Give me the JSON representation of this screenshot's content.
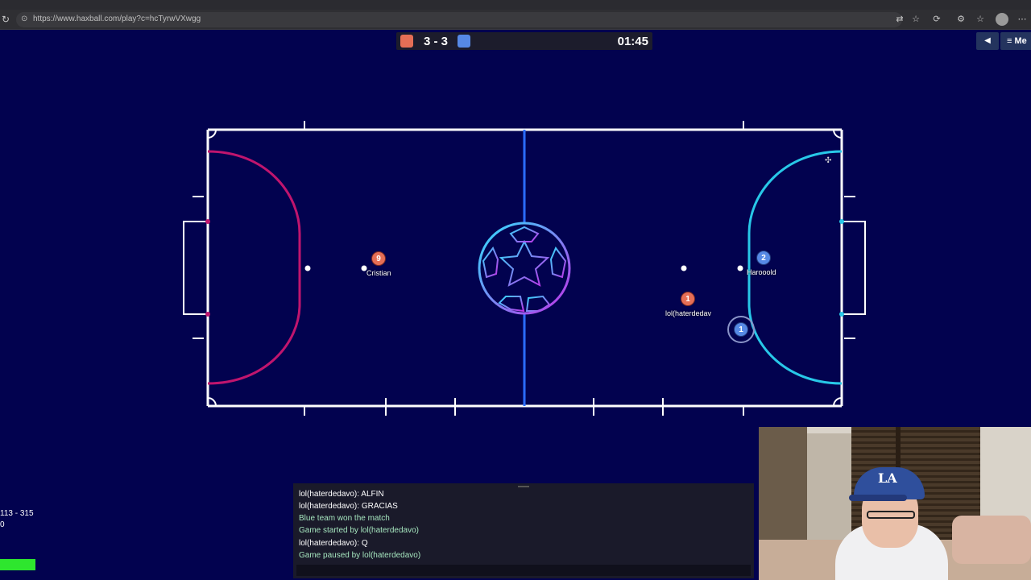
{
  "browser": {
    "url": "https://www.haxball.com/play?c=hcTyrwVXwgg"
  },
  "scoreboard": {
    "score": "3 - 3",
    "time": "01:45",
    "red_color": "#e56e56",
    "blue_color": "#5689e5"
  },
  "menu": {
    "menu_label": "≡ Me",
    "mute_icon": "speaker-icon"
  },
  "players": [
    {
      "number": "9",
      "name": "Cristian",
      "team": "red"
    },
    {
      "number": "2",
      "name": "Harooold",
      "team": "blue"
    },
    {
      "number": "1",
      "name": "lol(haterdedav",
      "team": "red"
    },
    {
      "number": "1",
      "name": "",
      "team": "blue"
    }
  ],
  "chat": {
    "lines": [
      "lol(haterdedavo): ALFIN",
      "lol(haterdedavo): GRACIAS",
      "Blue team won the match",
      "Game started by lol(haterdedavo)",
      "lol(haterdedavo): Q",
      "Game paused by lol(haterdedavo)"
    ]
  },
  "stats": {
    "fps": "113 - 315",
    "ping": "0"
  }
}
